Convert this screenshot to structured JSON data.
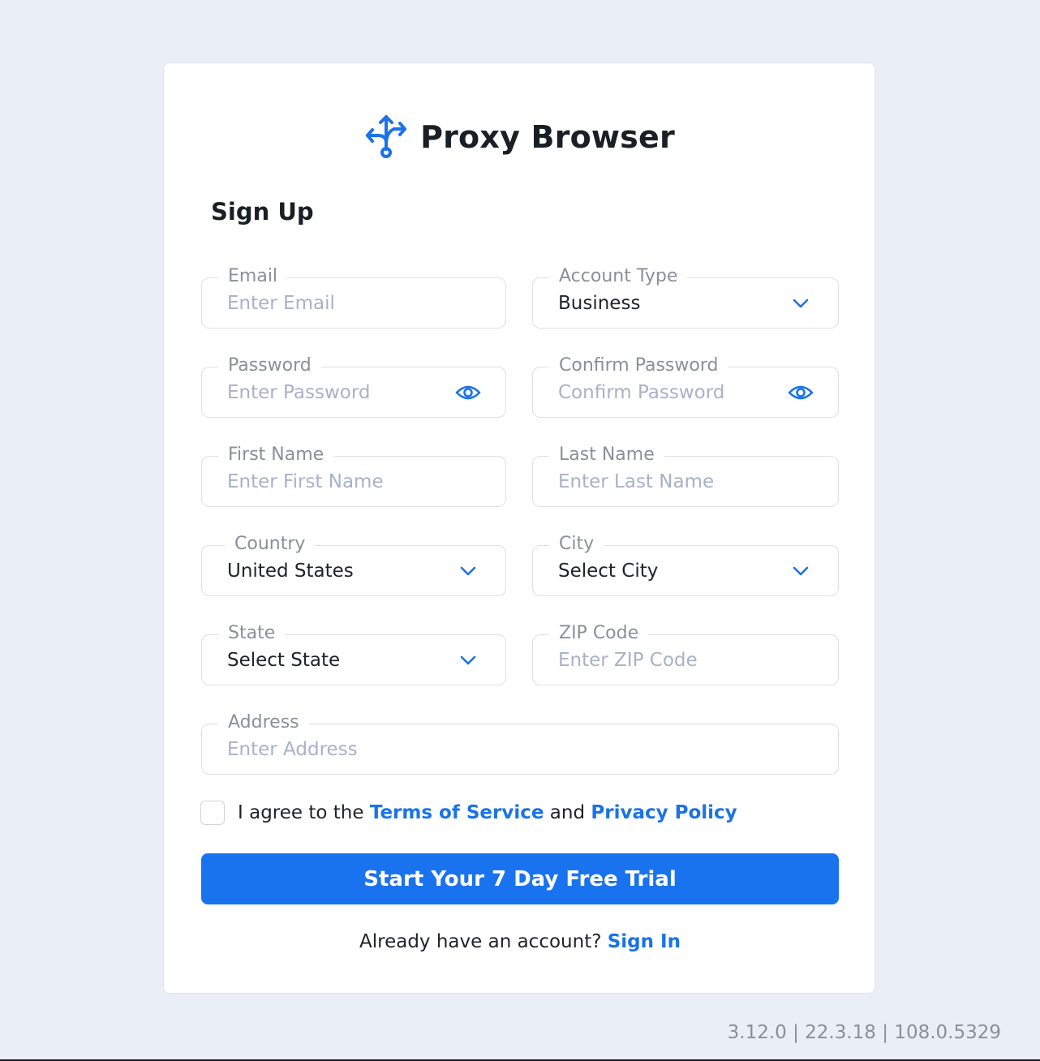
{
  "app": {
    "name": "Proxy Browser",
    "accent_color": "#1a73ee"
  },
  "form": {
    "title": "Sign Up",
    "email": {
      "label": "Email",
      "placeholder": "Enter Email"
    },
    "account_type": {
      "label": "Account Type",
      "value": "Business",
      "icon": "chevron-down-icon"
    },
    "password": {
      "label": "Password",
      "placeholder": "Enter Password",
      "icon": "eye-icon"
    },
    "confirm_password": {
      "label": "Confirm Password",
      "placeholder": "Confirm Password",
      "icon": "eye-icon"
    },
    "first_name": {
      "label": "First Name",
      "placeholder": "Enter First Name"
    },
    "last_name": {
      "label": "Last Name",
      "placeholder": "Enter Last Name"
    },
    "country": {
      "label": "Country",
      "value": "United States",
      "icon": "chevron-down-icon"
    },
    "city": {
      "label": "City",
      "value": "Select City",
      "icon": "chevron-down-icon"
    },
    "state": {
      "label": "State",
      "value": "Select State",
      "icon": "chevron-down-icon"
    },
    "zip": {
      "label": "ZIP Code",
      "placeholder": "Enter ZIP Code"
    },
    "address": {
      "label": "Address",
      "placeholder": "Enter Address"
    },
    "agree": {
      "prefix": "I agree to the",
      "terms_link": "Terms of Service",
      "conjunction": "and",
      "privacy_link": "Privacy Policy",
      "checked": false
    },
    "submit_label": "Start Your 7 Day Free Trial",
    "signin": {
      "prompt": "Already have an account?",
      "link": "Sign In"
    }
  },
  "footer": {
    "version": "3.12.0 | 22.3.18 | 108.0.5329"
  }
}
